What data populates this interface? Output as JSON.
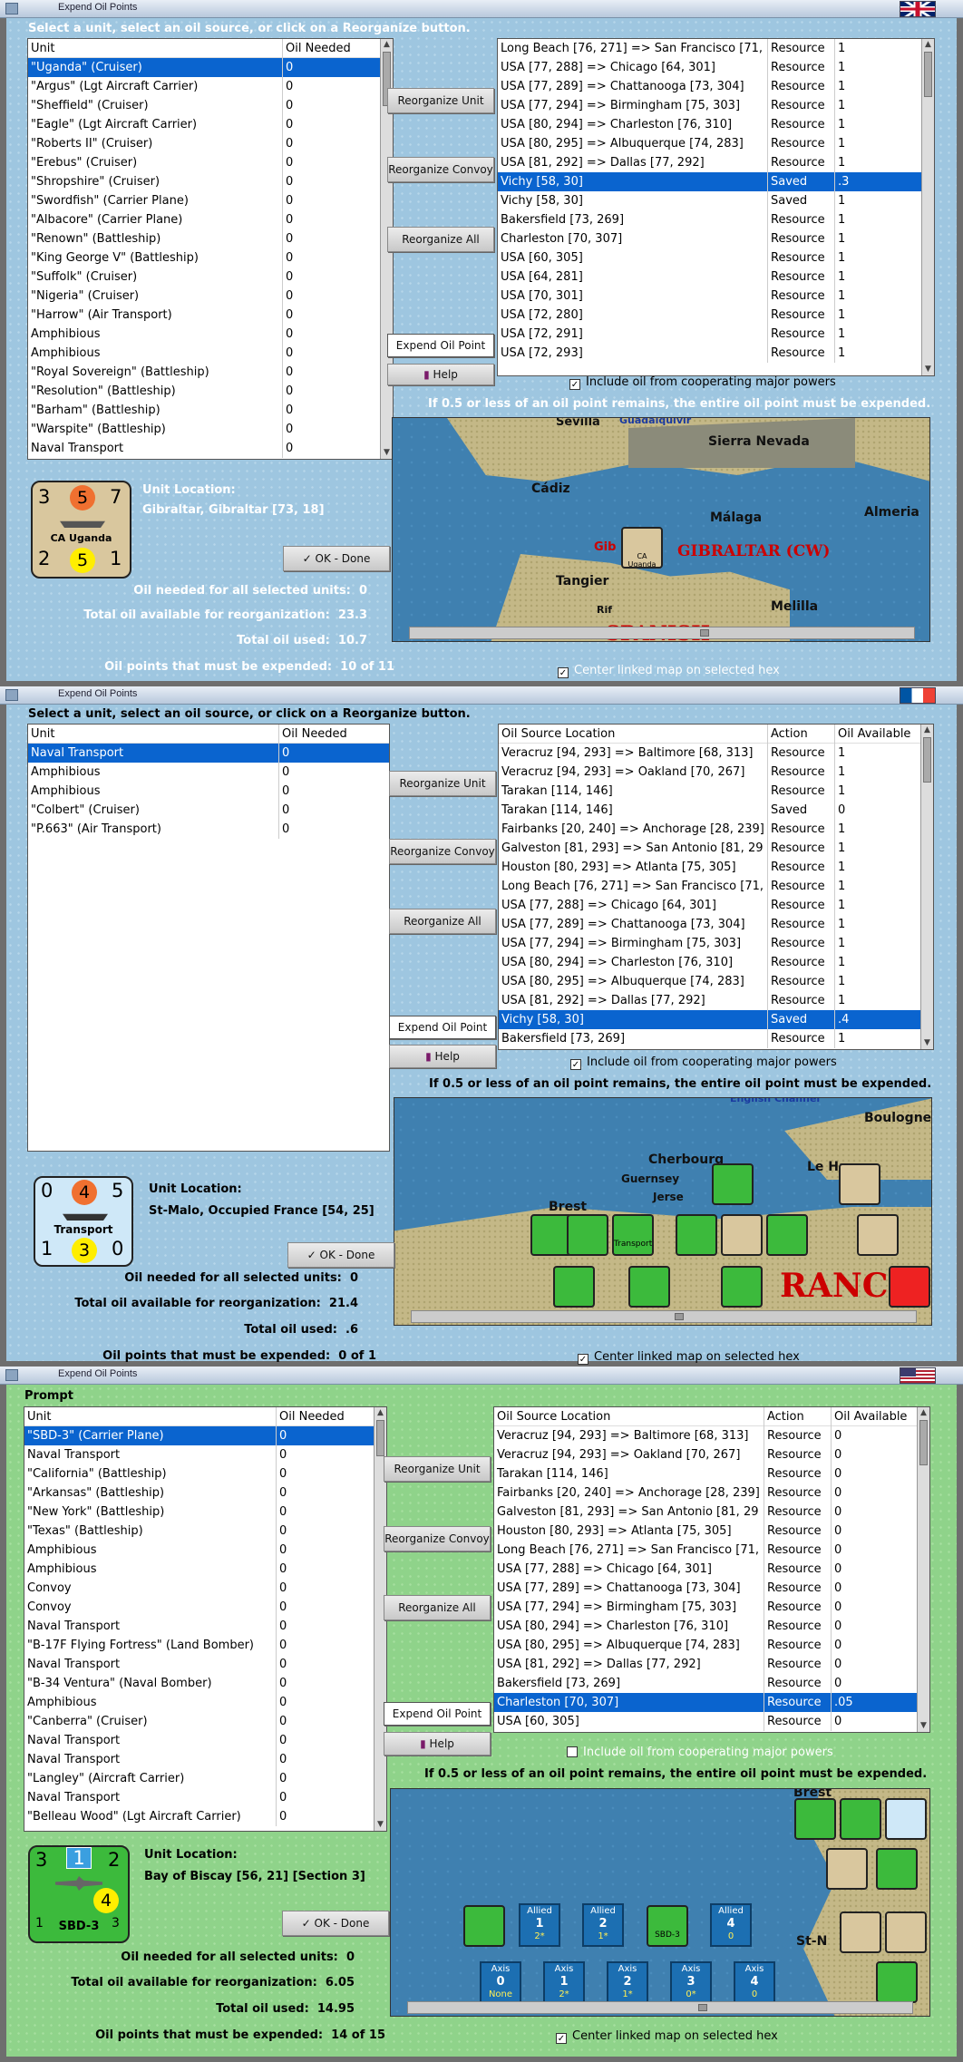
{
  "window1": {
    "title": "Expend Oil Points",
    "flag": "uk",
    "instruction": "Select a unit, select an oil source, or click on a Reorganize button.",
    "unit_list": {
      "headers": [
        "Unit",
        "Oil Needed"
      ],
      "rows": [
        [
          "\"Uganda\" (Cruiser)",
          "0"
        ],
        [
          "\"Argus\" (Lgt Aircraft Carrier)",
          "0"
        ],
        [
          "\"Sheffield\" (Cruiser)",
          "0"
        ],
        [
          "\"Eagle\" (Lgt Aircraft Carrier)",
          "0"
        ],
        [
          "\"Roberts II\" (Cruiser)",
          "0"
        ],
        [
          "\"Erebus\" (Cruiser)",
          "0"
        ],
        [
          "\"Shropshire\" (Cruiser)",
          "0"
        ],
        [
          "\"Swordfish\" (Carrier Plane)",
          "0"
        ],
        [
          "\"Albacore\" (Carrier Plane)",
          "0"
        ],
        [
          "\"Renown\" (Battleship)",
          "0"
        ],
        [
          "\"King George V\" (Battleship)",
          "0"
        ],
        [
          "\"Suffolk\" (Cruiser)",
          "0"
        ],
        [
          "\"Nigeria\" (Cruiser)",
          "0"
        ],
        [
          "\"Harrow\" (Air Transport)",
          "0"
        ],
        [
          "Amphibious",
          "0"
        ],
        [
          "Amphibious",
          "0"
        ],
        [
          "\"Royal Sovereign\" (Battleship)",
          "0"
        ],
        [
          "\"Resolution\" (Battleship)",
          "0"
        ],
        [
          "\"Barham\" (Battleship)",
          "0"
        ],
        [
          "\"Warspite\" (Battleship)",
          "0"
        ],
        [
          "Naval Transport",
          "0"
        ]
      ]
    },
    "oil_list": {
      "rows": [
        [
          "Long Beach [76, 271] => San Francisco [71,",
          "Resource",
          "1"
        ],
        [
          "USA [77, 288] => Chicago [64, 301]",
          "Resource",
          "1"
        ],
        [
          "USA [77, 289] => Chattanooga [73, 304]",
          "Resource",
          "1"
        ],
        [
          "USA [77, 294] => Birmingham [75, 303]",
          "Resource",
          "1"
        ],
        [
          "USA [80, 294] => Charleston [76, 310]",
          "Resource",
          "1"
        ],
        [
          "USA [80, 295] => Albuquerque [74, 283]",
          "Resource",
          "1"
        ],
        [
          "USA [81, 292] => Dallas [77, 292]",
          "Resource",
          "1"
        ],
        [
          "Vichy [58, 30]",
          "Saved",
          ".3"
        ],
        [
          "Vichy [58, 30]",
          "Saved",
          "1"
        ],
        [
          "Bakersfield [73, 269]",
          "Resource",
          "1"
        ],
        [
          "Charleston [70, 307]",
          "Resource",
          "1"
        ],
        [
          "USA [60, 305]",
          "Resource",
          "1"
        ],
        [
          "USA [64, 281]",
          "Resource",
          "1"
        ],
        [
          "USA [70, 301]",
          "Resource",
          "1"
        ],
        [
          "USA [72, 280]",
          "Resource",
          "1"
        ],
        [
          "USA [72, 291]",
          "Resource",
          "1"
        ],
        [
          "USA [72, 293]",
          "Resource",
          "1"
        ]
      ]
    },
    "buttons": {
      "reorg_unit": "Reorganize Unit",
      "reorg_convoy": "Reorganize Convoy",
      "reorg_all": "Reorganize All",
      "expend": "Expend Oil Point",
      "help": "Help",
      "ok": "OK - Done"
    },
    "include_oil": "Include oil from cooperating major powers",
    "rule_text": "If 0.5 or less of an oil point remains, the entire oil point must be expended.",
    "center_map": "Center linked map on selected hex",
    "unit_location_label": "Unit Location:",
    "unit_location": "Gibraltar, Gibraltar [73, 18]",
    "card": {
      "tl": "3",
      "tm": "5",
      "tr": "7",
      "bl": "2",
      "bm": "5",
      "br": "1",
      "name": "CA Uganda"
    },
    "stats": [
      [
        "Oil needed for all selected units:",
        "0"
      ],
      [
        "Total oil available for reorganization:",
        "23.3"
      ],
      [
        "Total oil used:",
        "10.7"
      ],
      [
        "Oil points that must be expended:",
        "10 of 11"
      ]
    ],
    "map_labels": {
      "seville": "Sevilla",
      "guadalquivir": "Guadalquivir",
      "sierra": "Sierra Nevada",
      "cadiz": "Cádiz",
      "malaga": "Málaga",
      "almeria": "Almeria",
      "gib": "Gib",
      "gibraltar": "GIBRALTAR (CW)",
      "tangier": "Tangier",
      "rif": "Rif",
      "melilla": "Melilla",
      "spanish": "SPANISH",
      "chip": "CA Uganda"
    }
  },
  "window2": {
    "title": "Expend Oil Points",
    "flag": "france",
    "instruction": "Select a unit, select an oil source, or click on a Reorganize button.",
    "unit_list": {
      "headers": [
        "Unit",
        "Oil Needed"
      ],
      "rows": [
        [
          "Naval Transport",
          "0"
        ],
        [
          "Amphibious",
          "0"
        ],
        [
          "Amphibious",
          "0"
        ],
        [
          "\"Colbert\" (Cruiser)",
          "0"
        ],
        [
          "\"P.663\" (Air Transport)",
          "0"
        ]
      ]
    },
    "oil_list": {
      "headers": [
        "Oil Source Location",
        "Action",
        "Oil Available"
      ],
      "rows": [
        [
          "Veracruz [94, 293] => Baltimore [68, 313]",
          "Resource",
          "1"
        ],
        [
          "Veracruz [94, 293] => Oakland [70, 267]",
          "Resource",
          "1"
        ],
        [
          "Tarakan [114, 146]",
          "Resource",
          "1"
        ],
        [
          "Tarakan [114, 146]",
          "Saved",
          "0"
        ],
        [
          "Fairbanks [20, 240] => Anchorage [28, 239]",
          "Resource",
          "1"
        ],
        [
          "Galveston [81, 293] => San Antonio [81, 29",
          "Resource",
          "1"
        ],
        [
          "Houston [80, 293] => Atlanta [75, 305]",
          "Resource",
          "1"
        ],
        [
          "Long Beach [76, 271] => San Francisco [71,",
          "Resource",
          "1"
        ],
        [
          "USA [77, 288] => Chicago [64, 301]",
          "Resource",
          "1"
        ],
        [
          "USA [77, 289] => Chattanooga [73, 304]",
          "Resource",
          "1"
        ],
        [
          "USA [77, 294] => Birmingham [75, 303]",
          "Resource",
          "1"
        ],
        [
          "USA [80, 294] => Charleston [76, 310]",
          "Resource",
          "1"
        ],
        [
          "USA [80, 295] => Albuquerque [74, 283]",
          "Resource",
          "1"
        ],
        [
          "USA [81, 292] => Dallas [77, 292]",
          "Resource",
          "1"
        ],
        [
          "Vichy [58, 30]",
          "Saved",
          ".4"
        ],
        [
          "Bakersfield [73, 269]",
          "Resource",
          "1"
        ]
      ]
    },
    "buttons": {
      "reorg_unit": "Reorganize Unit",
      "reorg_convoy": "Reorganize Convoy",
      "reorg_all": "Reorganize All",
      "expend": "Expend Oil Point",
      "help": "Help",
      "ok": "OK - Done"
    },
    "include_oil": "Include oil from cooperating major powers",
    "rule_text": "If 0.5 or less of an oil point remains, the entire oil point must be expended.",
    "center_map": "Center linked map on selected hex",
    "unit_location_label": "Unit Location:",
    "unit_location": "St-Malo, Occupied France [54, 25]",
    "card": {
      "tl": "0",
      "tm": "4",
      "tr": "5",
      "bl": "1",
      "bm": "3",
      "br": "0",
      "name": "Transport"
    },
    "stats": [
      [
        "Oil needed for all selected units:",
        "0"
      ],
      [
        "Total oil available for reorganization:",
        "21.4"
      ],
      [
        "Total oil used:",
        ".6"
      ],
      [
        "Oil points that must be expended:",
        "0 of 1"
      ]
    ],
    "map_labels": {
      "channel": "English Channel",
      "boulogne": "Boulogne",
      "cherbourg": "Cherbourg",
      "lehavre": "Le Havre",
      "guernsey": "Guernsey",
      "jersey": "Jerse",
      "brest": "Brest",
      "franc": "RANC",
      "chip": "Transport"
    }
  },
  "window3": {
    "title": "Expend Oil Points",
    "flag": "usa",
    "instruction": "Prompt",
    "unit_list": {
      "headers": [
        "Unit",
        "Oil Needed"
      ],
      "rows": [
        [
          "\"SBD-3\" (Carrier Plane)",
          "0"
        ],
        [
          "Naval Transport",
          "0"
        ],
        [
          "\"California\" (Battleship)",
          "0"
        ],
        [
          "\"Arkansas\" (Battleship)",
          "0"
        ],
        [
          "\"New York\" (Battleship)",
          "0"
        ],
        [
          "\"Texas\" (Battleship)",
          "0"
        ],
        [
          "Amphibious",
          "0"
        ],
        [
          "Amphibious",
          "0"
        ],
        [
          "Convoy",
          "0"
        ],
        [
          "Convoy",
          "0"
        ],
        [
          "Naval Transport",
          "0"
        ],
        [
          "\"B-17F Flying Fortress\" (Land Bomber)",
          "0"
        ],
        [
          "Naval Transport",
          "0"
        ],
        [
          "\"B-34 Ventura\" (Naval Bomber)",
          "0"
        ],
        [
          "Amphibious",
          "0"
        ],
        [
          "\"Canberra\" (Cruiser)",
          "0"
        ],
        [
          "Naval Transport",
          "0"
        ],
        [
          "Naval Transport",
          "0"
        ],
        [
          "\"Langley\" (Aircraft Carrier)",
          "0"
        ],
        [
          "Naval Transport",
          "0"
        ],
        [
          "\"Belleau Wood\" (Lgt Aircraft Carrier)",
          "0"
        ]
      ]
    },
    "oil_list": {
      "headers": [
        "Oil Source Location",
        "Action",
        "Oil Available"
      ],
      "rows": [
        [
          "Veracruz [94, 293] => Baltimore [68, 313]",
          "Resource",
          "0"
        ],
        [
          "Veracruz [94, 293] => Oakland [70, 267]",
          "Resource",
          "0"
        ],
        [
          "Tarakan [114, 146]",
          "Resource",
          "0"
        ],
        [
          "Fairbanks [20, 240] => Anchorage [28, 239]",
          "Resource",
          "0"
        ],
        [
          "Galveston [81, 293] => San Antonio [81, 29",
          "Resource",
          "0"
        ],
        [
          "Houston [80, 293] => Atlanta [75, 305]",
          "Resource",
          "0"
        ],
        [
          "Long Beach [76, 271] => San Francisco [71,",
          "Resource",
          "0"
        ],
        [
          "USA [77, 288] => Chicago [64, 301]",
          "Resource",
          "0"
        ],
        [
          "USA [77, 289] => Chattanooga [73, 304]",
          "Resource",
          "0"
        ],
        [
          "USA [77, 294] => Birmingham [75, 303]",
          "Resource",
          "0"
        ],
        [
          "USA [80, 294] => Charleston [76, 310]",
          "Resource",
          "0"
        ],
        [
          "USA [80, 295] => Albuquerque [74, 283]",
          "Resource",
          "0"
        ],
        [
          "USA [81, 292] => Dallas [77, 292]",
          "Resource",
          "0"
        ],
        [
          "Bakersfield [73, 269]",
          "Resource",
          "0"
        ],
        [
          "Charleston [70, 307]",
          "Resource",
          ".05"
        ],
        [
          "USA [60, 305]",
          "Resource",
          "0"
        ]
      ]
    },
    "buttons": {
      "reorg_unit": "Reorganize Unit",
      "reorg_convoy": "Reorganize Convoy",
      "reorg_all": "Reorganize All",
      "expend": "Expend Oil Point",
      "help": "Help",
      "ok": "OK - Done"
    },
    "include_oil": "Include oil from cooperating major powers",
    "rule_text": "If 0.5 or less of an oil point remains, the entire oil point must be expended.",
    "center_map": "Center linked map on selected hex",
    "unit_location_label": "Unit Location:",
    "unit_location": "Bay of Biscay [56, 21] [Section 3]",
    "card": {
      "tl": "3",
      "tm": "1",
      "tr": "2",
      "bl": "1",
      "bm": "4",
      "br": "3",
      "name": "SBD-3"
    },
    "stats": [
      [
        "Oil needed for all selected units:",
        "0"
      ],
      [
        "Total oil available for reorganization:",
        "6.05"
      ],
      [
        "Total oil used:",
        "14.95"
      ],
      [
        "Oil points that must be expended:",
        "14 of 15"
      ]
    ],
    "map_labels": {
      "brest": "Brest",
      "stn": "St-N",
      "chip": "SBD-3"
    },
    "boxes": {
      "allied": [
        [
          "Allied",
          "1",
          "2*"
        ],
        [
          "Allied",
          "2",
          "1*"
        ],
        [
          "Allied",
          "4",
          "0"
        ]
      ],
      "axis": [
        [
          "Axis",
          "0",
          "None"
        ],
        [
          "Axis",
          "1",
          "2*"
        ],
        [
          "Axis",
          "2",
          "1*"
        ],
        [
          "Axis",
          "3",
          "0*"
        ],
        [
          "Axis",
          "4",
          "0"
        ]
      ]
    }
  }
}
